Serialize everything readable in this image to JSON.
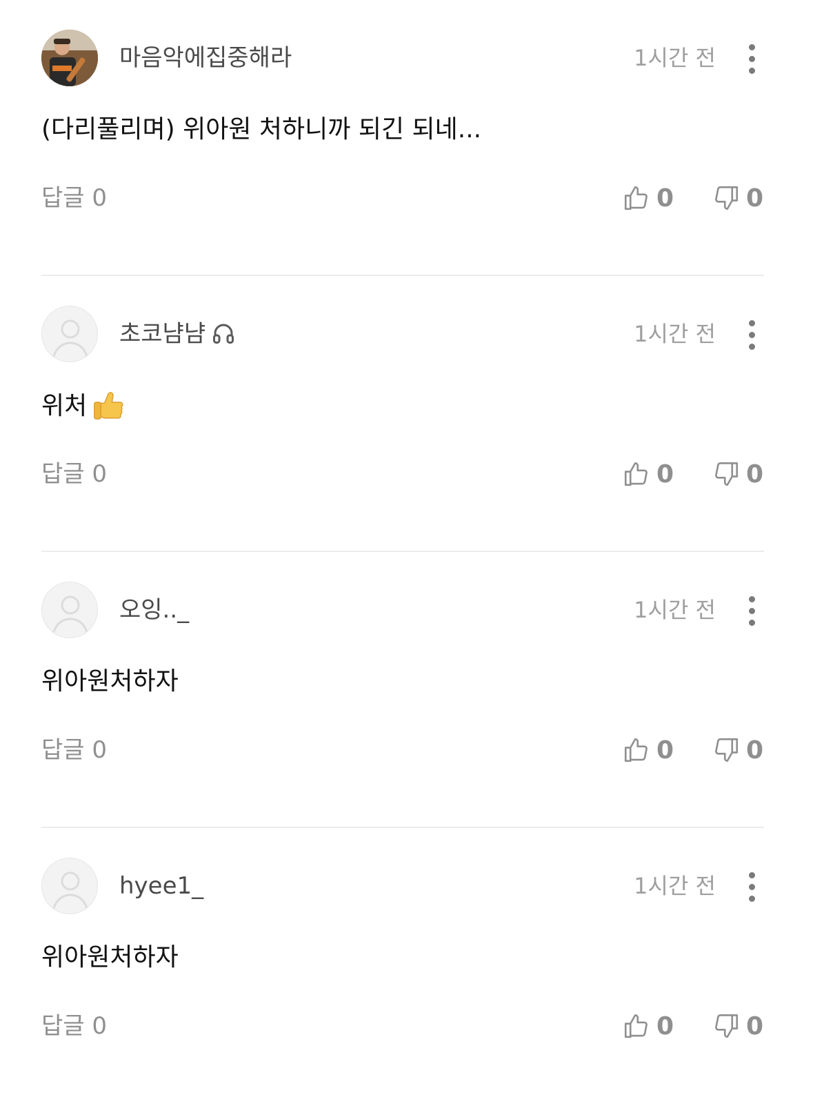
{
  "comments": [
    {
      "username": "마음악에집중해라",
      "avatar": "user-photo",
      "time": "1시간 전",
      "text": "(다리풀리며) 위아원 처하니까 되긴 되네...",
      "reply_label": "답글 0",
      "likes": "0",
      "dislikes": "0"
    },
    {
      "username": "초코냠냠",
      "badge_icon": "headphones-icon",
      "avatar": "default-avatar",
      "time": "1시간 전",
      "text": "위처",
      "emoji": "thumbs-up-emoji",
      "reply_label": "답글 0",
      "likes": "0",
      "dislikes": "0"
    },
    {
      "username": "오잉.._",
      "avatar": "default-avatar",
      "time": "1시간 전",
      "text": "위아원처하자",
      "reply_label": "답글 0",
      "likes": "0",
      "dislikes": "0"
    },
    {
      "username": "hyee1_",
      "avatar": "default-avatar",
      "time": "1시간 전",
      "text": "위아원처하자",
      "reply_label": "답글 0",
      "likes": "0",
      "dislikes": "0"
    }
  ],
  "colors": {
    "username": "#4a4a4a",
    "muted": "#9e9e9e",
    "divider": "#ececec",
    "body_text": "#111111"
  }
}
